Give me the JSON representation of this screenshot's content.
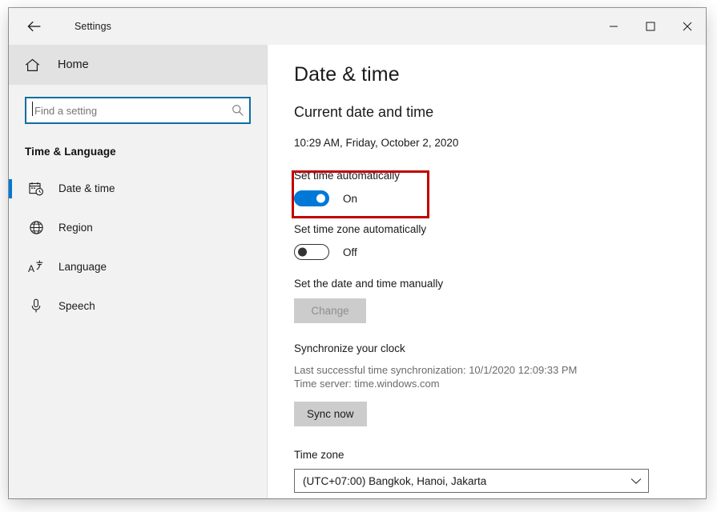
{
  "window": {
    "title": "Settings",
    "back_icon": "back-arrow-icon",
    "minimize_label": "─",
    "maximize_label": "□",
    "close_label": "✕"
  },
  "sidebar": {
    "home": {
      "label": "Home",
      "icon": "home-icon"
    },
    "search": {
      "value": "",
      "placeholder": "Find a setting",
      "icon": "search-icon"
    },
    "section_title": "Time & Language",
    "items": [
      {
        "label": "Date & time",
        "icon": "calendar-clock-icon",
        "selected": true
      },
      {
        "label": "Region",
        "icon": "globe-icon",
        "selected": false
      },
      {
        "label": "Language",
        "icon": "language-icon",
        "selected": false
      },
      {
        "label": "Speech",
        "icon": "microphone-icon",
        "selected": false
      }
    ]
  },
  "main": {
    "page_title": "Date & time",
    "current_section_heading": "Current date and time",
    "current_datetime": "10:29 AM, Friday, October 2, 2020",
    "set_time_auto": {
      "label": "Set time automatically",
      "state": "On",
      "on": true,
      "highlighted": true
    },
    "set_timezone_auto": {
      "label": "Set time zone automatically",
      "state": "Off",
      "on": false
    },
    "manual": {
      "label": "Set the date and time manually",
      "button_label": "Change",
      "button_disabled": true
    },
    "sync": {
      "heading": "Synchronize your clock",
      "last_sync": "Last successful time synchronization: 10/1/2020 12:09:33 PM",
      "time_server": "Time server: time.windows.com",
      "button_label": "Sync now",
      "button_disabled": false
    },
    "timezone": {
      "label": "Time zone",
      "selected": "(UTC+07:00) Bangkok, Hanoi, Jakarta",
      "chevron_icon": "chevron-down-icon"
    }
  },
  "colors": {
    "accent": "#0078D7",
    "highlight_box": "#C00000",
    "sidebar_bg": "#F2F2F2",
    "home_row_bg": "#E2E2E2",
    "search_border": "#0D6EA1",
    "button_bg": "#CCCCCC"
  }
}
